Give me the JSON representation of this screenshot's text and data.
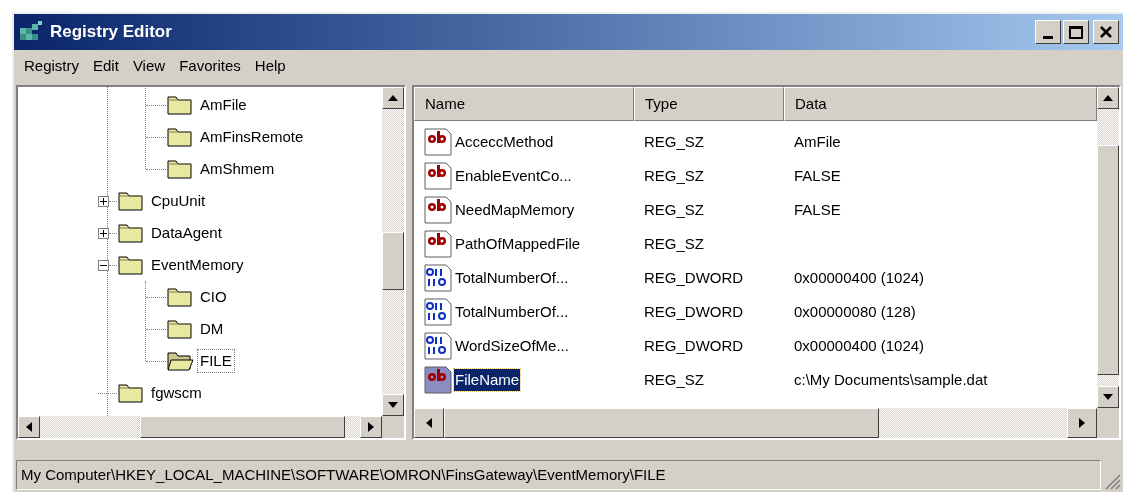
{
  "window": {
    "title": "Registry Editor"
  },
  "menu": [
    "Registry",
    "Edit",
    "View",
    "Favorites",
    "Help"
  ],
  "tree": {
    "continued_children": [
      {
        "label": "AmFile",
        "selected": false
      },
      {
        "label": "AmFinsRemote",
        "selected": false
      },
      {
        "label": "AmShmem",
        "selected": false
      }
    ],
    "items": [
      {
        "label": "CpuUnit",
        "selected": false,
        "expanded": false
      },
      {
        "label": "DataAgent",
        "selected": false,
        "expanded": false
      },
      {
        "label": "EventMemory",
        "selected": false,
        "expanded": true,
        "children": [
          {
            "label": "CIO",
            "selected": false
          },
          {
            "label": "DM",
            "selected": false
          },
          {
            "label": "FILE",
            "selected": true
          }
        ]
      },
      {
        "label": "fgwscm",
        "selected": false
      }
    ]
  },
  "values": {
    "columns": [
      "Name",
      "Type",
      "Data"
    ],
    "rows": [
      {
        "kind": "string",
        "name": "AcceccMethod",
        "type": "REG_SZ",
        "data": "AmFile",
        "selected": false
      },
      {
        "kind": "string",
        "name": "EnableEventCo...",
        "type": "REG_SZ",
        "data": "FALSE",
        "selected": false
      },
      {
        "kind": "string",
        "name": "NeedMapMemory",
        "type": "REG_SZ",
        "data": "FALSE",
        "selected": false
      },
      {
        "kind": "string",
        "name": "PathOfMappedFile",
        "type": "REG_SZ",
        "selected": false
      },
      {
        "kind": "dword",
        "name": "TotalNumberOf...",
        "type": "REG_DWORD",
        "data": "0x00000400 (1024)",
        "selected": false
      },
      {
        "kind": "dword",
        "name": "TotalNumberOf...",
        "type": "REG_DWORD",
        "data": "0x00000080 (128)",
        "selected": false
      },
      {
        "kind": "dword",
        "name": "WordSizeOfMe...",
        "type": "REG_DWORD",
        "data": "0x00000400 (1024)",
        "selected": false
      },
      {
        "kind": "string",
        "name": "FileName",
        "type": "REG_SZ",
        "data": "c:\\My Documents\\sample.dat",
        "selected": true
      }
    ]
  },
  "status_bar": "My Computer\\HKEY_LOCAL_MACHINE\\SOFTWARE\\OMRON\\FinsGateway\\EventMemory\\FILE"
}
